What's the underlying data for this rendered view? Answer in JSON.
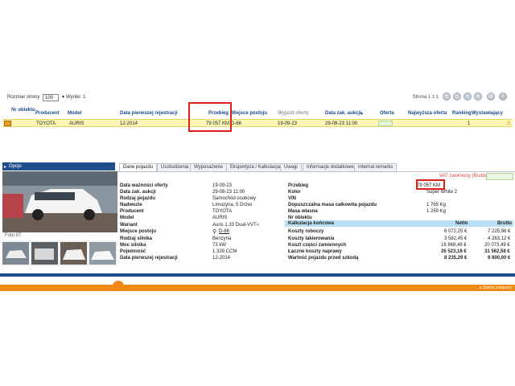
{
  "topbar": {
    "page_size_label": "Rozmiar strony",
    "page_size_value": "100",
    "results_label": "Wyniki: 1",
    "pager_label": "Strona 1 z 1"
  },
  "grid": {
    "headers": [
      "Nr obiektu",
      "Producent",
      "Model",
      "Data pierwszej rejestracji",
      "Przebieg",
      "Miejsce postoju",
      "Wyjazd oferty",
      "Data zak. aukcji",
      "Oferta",
      "Najwyższa oferta",
      "Ranking",
      "Wystawiający"
    ],
    "row": {
      "producer": "TOYOTA",
      "model": "AURIS",
      "first_reg": "12-2014",
      "mileage": "79 057 KM",
      "location": "D-66",
      "offer_exp": "19-09-23",
      "auction_end": "29-08-23 11:00",
      "ranking": "1"
    }
  },
  "options_label": "Opcje",
  "photo_caption": "Foto 07",
  "tabs": [
    "Dane pojazdu",
    "Uszkodzenia",
    "Wyposażenie",
    "Ekspertyza / Kalkulacja",
    "Uwagi",
    "Informacje dodatkowe",
    "Internal remarks"
  ],
  "vat_label": "VAT zwolniony (Brutto)",
  "details_left": [
    {
      "label": "Data ważności oferty",
      "value": "19-09-23"
    },
    {
      "label": "Data zak. aukcji",
      "value": "29-08-23 11:00"
    },
    {
      "label": "Rodzaj pojazdu",
      "value": "Samochód osobowy"
    },
    {
      "label": "Nadwozie",
      "value": "Limuzyna, 5 Drzwi"
    },
    {
      "label": "Producent",
      "value": "TOYOTA"
    },
    {
      "label": "Model",
      "value": "AURIS"
    },
    {
      "label": "Wariant",
      "value": "Auris 1.33 Dual-VVT-i"
    },
    {
      "label": "Miejsce postoju",
      "value": "D-66"
    },
    {
      "label": "Rodzaj silnika",
      "value": "Benzyna"
    },
    {
      "label": "Moc silnika",
      "value": "73 kW"
    },
    {
      "label": "Pojemność",
      "value": "1 329 CCM"
    },
    {
      "label": "Data pierwszej rejestracji",
      "value": "12-2014"
    }
  ],
  "details_right": [
    {
      "label": "Przebieg",
      "value": "79 057 KM"
    },
    {
      "label": "Kolor",
      "value": "Super White 2"
    },
    {
      "label": "VIN",
      "value": ""
    },
    {
      "label": "Dopuszczalna masa całkowita pojazdu",
      "value": "1 765 Kg"
    },
    {
      "label": "Masa własna",
      "value": "1 250 Kg"
    },
    {
      "label": "Nr obiektu",
      "value": ""
    }
  ],
  "calc": {
    "title": "Kalkulacja końcowa",
    "netto": "Netto",
    "brutto": "Brutto",
    "rows": [
      {
        "label": "Koszty roboczy",
        "netto": "6 072,25 €",
        "brutto": "7 225,98 €"
      },
      {
        "label": "Koszty lakierowania",
        "netto": "3 582,45 €",
        "brutto": "4 263,12 €"
      },
      {
        "label": "Koszt części zamiennych",
        "netto": "16 868,48 €",
        "brutto": "20 073,49 €"
      },
      {
        "label": "Łączne koszty naprawy",
        "netto": "26 523,18 €",
        "brutto": "31 562,58 €"
      },
      {
        "label": "Wartość pojazdu przed szkodą",
        "netto": "8 235,29 €",
        "brutto": "9 800,00 €"
      }
    ]
  },
  "footer_text": "a Solera company"
}
